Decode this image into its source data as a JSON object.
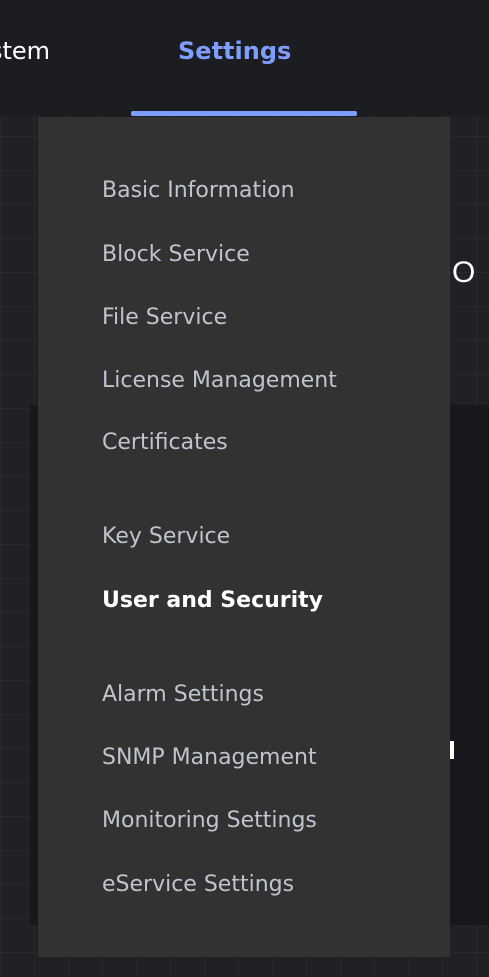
{
  "nav": {
    "tabs": [
      {
        "label": "stem"
      },
      {
        "label": "Settings"
      }
    ]
  },
  "background": {
    "partial_heading": "O",
    "partial_mark": "|"
  },
  "settings_menu": {
    "items": [
      {
        "label": "Basic Information"
      },
      {
        "label": "Block Service"
      },
      {
        "label": "File Service"
      },
      {
        "label": "License Management"
      },
      {
        "label": "Certificates"
      },
      {
        "label": "Key Service"
      },
      {
        "label": "User and Security"
      },
      {
        "label": "Alarm Settings"
      },
      {
        "label": "SNMP Management"
      },
      {
        "label": "Monitoring Settings"
      },
      {
        "label": "eService Settings"
      }
    ],
    "active_index": 6
  },
  "colors": {
    "accent": "#7e9eff",
    "menu_bg": "#323232",
    "menu_text": "#bfc4ce",
    "active_text": "#ffffff",
    "page_bg": "#1f2125"
  }
}
